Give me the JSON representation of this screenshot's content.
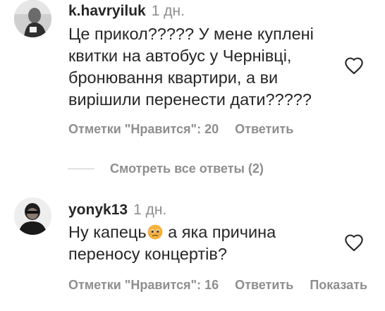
{
  "comments": [
    {
      "username": "k.havryiluk",
      "time": "1 дн.",
      "text_lines": [
        "Це прикол????? У мене куплені",
        "квитки на автобус у Чернівці,",
        "бронювання квартири, а ви",
        "вирішили перенести дати?????"
      ],
      "likes_label": "Отметки \"Нравится\": 20",
      "reply_label": "Ответить",
      "like_icon": "heart-outline-icon",
      "avatar_icon": "user-avatar"
    },
    {
      "username": "yonyk13",
      "time": "1 дн.",
      "text_line1_before": "Ну капець",
      "text_line1_after": " а яка причина",
      "text_line2": "переносу концертів?",
      "emoji_icon": "pleading-face-emoji",
      "likes_label": "Отметки \"Нравится\": 16",
      "reply_label": "Ответить",
      "translate_label": "Показать",
      "like_icon": "heart-outline-icon",
      "avatar_icon": "user-avatar"
    }
  ],
  "view_replies_label": "Смотреть все ответы (2)",
  "colors": {
    "text": "#262626",
    "secondary": "#8e8e8e",
    "divider": "#c7c7c7"
  }
}
